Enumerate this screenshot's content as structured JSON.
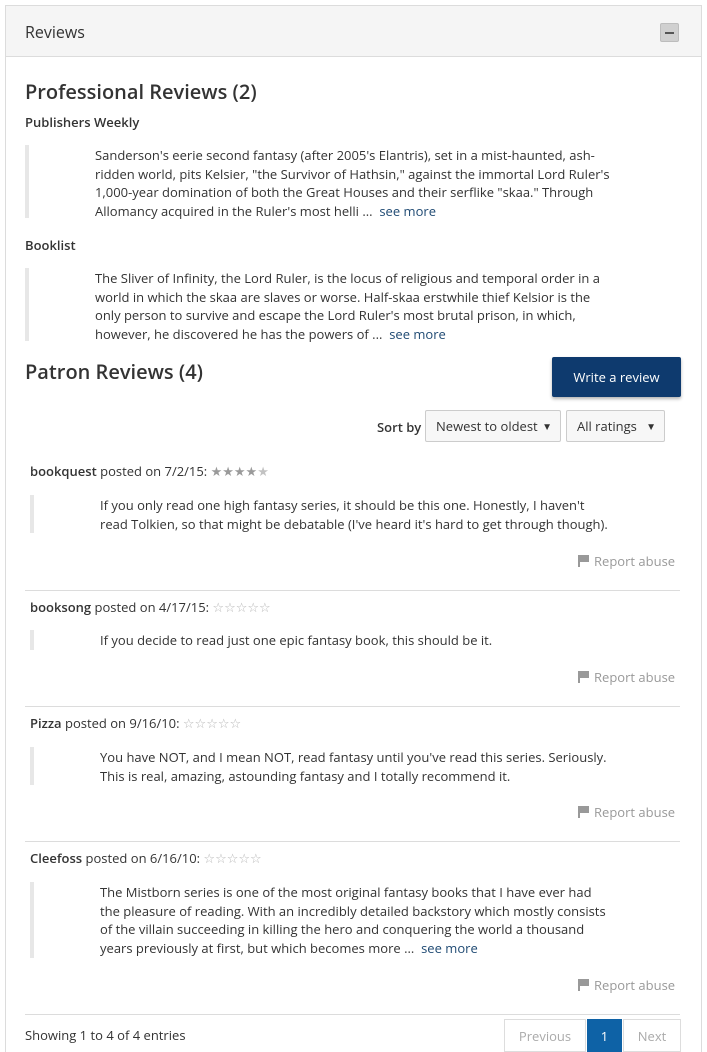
{
  "panel": {
    "title": "Reviews"
  },
  "professional": {
    "heading": "Professional Reviews (2)",
    "reviews": [
      {
        "source": "Publishers Weekly",
        "lines": [
          "Sanderson's eerie second fantasy (after 2005's Elantris), set in a mist-haunted, ash-",
          "ridden world, pits Kelsier, \"the Survivor of Hathsin,\" against the immortal Lord Ruler's",
          "1,000-year domination of both the Great Houses and their serflike \"skaa.\" Through",
          "Allomancy acquired in the Ruler's most helli ..."
        ],
        "see_more": "see more"
      },
      {
        "source": "Booklist",
        "lines": [
          "The Sliver of Infinity, the Lord Ruler, is the locus of religious and temporal order in a",
          "world in which the skaa are slaves or worse. Half-skaa erstwhile thief Kelsior is the",
          "only person to survive and escape the Lord Ruler's most brutal prison, in which,",
          "however, he discovered he has the powers of ..."
        ],
        "see_more": "see more"
      }
    ]
  },
  "patron": {
    "heading": "Patron Reviews (4)",
    "write_button": "Write a review",
    "sort_label": "Sort by",
    "sort_value": "Newest to oldest",
    "rating_value": "All ratings",
    "report_label": "Report abuse",
    "reviews": [
      {
        "user": "bookquest",
        "posted": " posted on 7/2/15: ",
        "rating": 4.5,
        "lines": [
          "If you only read one high fantasy series, it should be this one. Honestly, I haven't",
          "read Tolkien, so that might be debatable (I've heard it's hard to get through though)."
        ]
      },
      {
        "user": "booksong",
        "posted": " posted on 4/17/15: ",
        "rating": 0,
        "lines": [
          "If you decide to read just one epic fantasy book, this should be it."
        ]
      },
      {
        "user": "Pizza",
        "posted": " posted on 9/16/10: ",
        "rating": 0,
        "lines": [
          "You have NOT, and I mean NOT, read fantasy until you've read this series. Seriously.",
          "This is real, amazing, astounding fantasy and I totally recommend it."
        ]
      },
      {
        "user": "Cleefoss",
        "posted": " posted on 6/16/10: ",
        "rating": 0,
        "lines": [
          "The Mistborn series is one of the most original fantasy books that I have ever had",
          "the pleasure of reading. With an incredibly detailed backstory which mostly consists",
          "of the villain succeeding in killing the hero and conquering the world a thousand",
          "years previously at first, but which becomes more ..."
        ],
        "see_more": "see more"
      }
    ]
  },
  "footer": {
    "entries_text": "Showing 1 to 4 of 4 entries",
    "previous": "Previous",
    "page": "1",
    "next": "Next"
  }
}
